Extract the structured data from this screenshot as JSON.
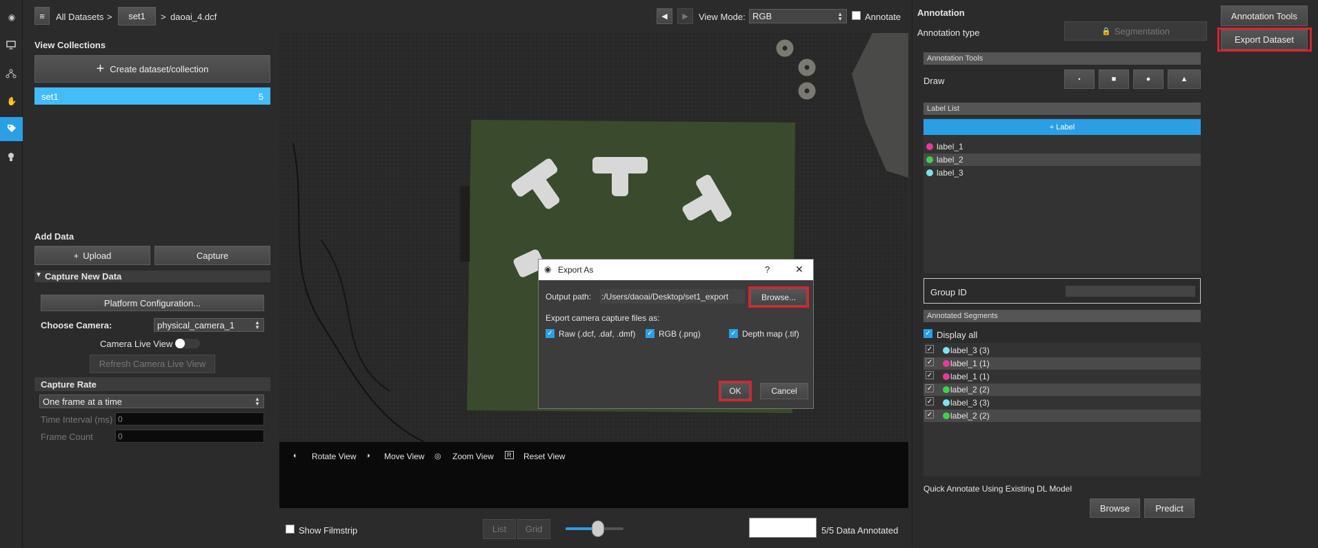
{
  "nav": {
    "icons": [
      "eye-icon",
      "monitor-icon",
      "network-icon",
      "hand-icon",
      "tag-icon",
      "bulb-icon"
    ]
  },
  "breadcrumb": {
    "menu": "≡",
    "all_datasets": "All Datasets",
    "sep1": ">",
    "set": "set1",
    "sep2": ">",
    "file": "daoai_4.dcf"
  },
  "toolbar": {
    "view_mode_label": "View Mode:",
    "view_mode_value": "RGB",
    "annotate_label": "Annotate"
  },
  "left": {
    "view_collections": "View Collections",
    "create_btn": "Create dataset/collection",
    "collection": {
      "name": "set1",
      "count": "5"
    },
    "add_data": "Add Data",
    "upload": "Upload",
    "capture": "Capture",
    "capture_new": "Capture New Data",
    "platform_config": "Platform Configuration...",
    "choose_camera": "Choose Camera:",
    "camera_value": "physical_camera_1",
    "camera_live": "Camera Live View",
    "refresh": "Refresh Camera Live View",
    "capture_rate": "Capture Rate",
    "rate_value": "One frame at a time",
    "time_interval": "Time Interval (ms)",
    "time_value": "0",
    "frame_count": "Frame Count",
    "frame_value": "0"
  },
  "viewer": {
    "rotate": "Rotate View",
    "move": "Move View",
    "zoom": "Zoom View",
    "reset": "Reset View",
    "m1": "◐",
    "m2": "◑",
    "m3": "◎",
    "r": "R"
  },
  "bottom": {
    "filmstrip": "Show Filmstrip",
    "list": "List",
    "grid": "Grid",
    "slider_value": 0.55,
    "annotated": "5/5 Data Annotated"
  },
  "dialog": {
    "title": "Export As",
    "help": "?",
    "close": "✕",
    "output_label": "Output path:",
    "output_value": ":/Users/daoai/Desktop/set1_export",
    "browse": "Browse...",
    "export_label": "Export camera capture files as:",
    "raw": "Raw (.dcf, .daf, .dmf)",
    "rgb": "RGB (.png)",
    "depth": "Depth map (.tif)",
    "ok": "OK",
    "cancel": "Cancel"
  },
  "annotation": {
    "title": "Annotation",
    "type_label": "Annotation type",
    "type_value": "Segmentation",
    "tools": "Annotation Tools",
    "draw": "Draw",
    "label_list": "Label List",
    "add_label": "+ Label",
    "labels": [
      {
        "name": "label_1",
        "color": "#e83a9a"
      },
      {
        "name": "label_2",
        "color": "#3fd14a"
      },
      {
        "name": "label_3",
        "color": "#7ee0ee"
      }
    ],
    "group_id": "Group ID",
    "annotated_segments": "Annotated Segments",
    "display_all": "Display all",
    "segments": [
      {
        "name": "label_3 (3)",
        "color": "#7ee0ee"
      },
      {
        "name": "label_1 (1)",
        "color": "#e83a9a"
      },
      {
        "name": "label_1 (1)",
        "color": "#e83a9a"
      },
      {
        "name": "label_2 (2)",
        "color": "#3fd14a"
      },
      {
        "name": "label_3 (3)",
        "color": "#7ee0ee"
      },
      {
        "name": "label_2 (2)",
        "color": "#3fd14a"
      }
    ],
    "quick": "Quick Annotate Using Existing DL Model",
    "browse": "Browse",
    "predict": "Predict"
  },
  "farright": {
    "tools": "Annotation Tools",
    "export": "Export Dataset"
  }
}
